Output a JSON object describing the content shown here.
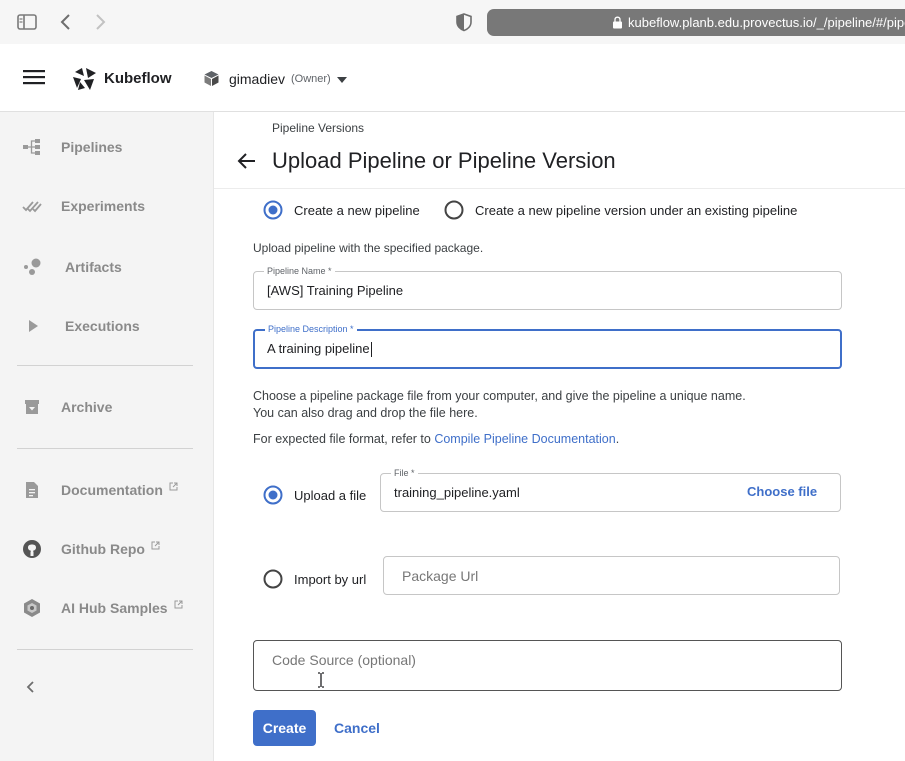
{
  "browser": {
    "url": "kubeflow.planb.edu.provectus.io/_/pipeline/#/pipeline_versions/new"
  },
  "header": {
    "brand": "Kubeflow",
    "namespace": "gimadiev",
    "namespace_role": "(Owner)"
  },
  "sidebar": {
    "items": [
      {
        "label": "Pipelines",
        "icon": "pipelines-icon"
      },
      {
        "label": "Experiments",
        "icon": "experiments-icon"
      },
      {
        "label": "Artifacts",
        "icon": "artifacts-icon"
      },
      {
        "label": "Executions",
        "icon": "executions-icon"
      },
      {
        "label": "Archive",
        "icon": "archive-icon"
      },
      {
        "label": "Documentation",
        "icon": "document-icon"
      },
      {
        "label": "Github Repo",
        "icon": "github-icon"
      },
      {
        "label": "AI Hub Samples",
        "icon": "ai-hub-icon"
      }
    ]
  },
  "main": {
    "breadcrumb": "Pipeline Versions",
    "title": "Upload Pipeline or Pipeline Version",
    "mode_options": {
      "new_pipeline": "Create a new pipeline",
      "new_version": "Create a new pipeline version under an existing pipeline",
      "selected": "new_pipeline"
    },
    "upload_helper": "Upload pipeline with the specified package.",
    "pipeline_name": {
      "label": "Pipeline Name *",
      "value": "[AWS] Training Pipeline"
    },
    "pipeline_description": {
      "label": "Pipeline Description *",
      "value": "A training pipeline"
    },
    "instructions": {
      "line1": "Choose a pipeline package file from your computer, and give the pipeline a unique name.",
      "line2": "You can also drag and drop the file here.",
      "format_prefix": "For expected file format, refer to ",
      "format_link": "Compile Pipeline Documentation",
      "format_suffix": "."
    },
    "source_options": {
      "upload_file": "Upload a file",
      "import_url": "Import by url",
      "selected": "upload_file"
    },
    "file": {
      "label": "File *",
      "value": "training_pipeline.yaml",
      "choose_label": "Choose file"
    },
    "package_url": {
      "placeholder": "Package Url"
    },
    "code_source": {
      "placeholder": "Code Source (optional)"
    },
    "create_label": "Create",
    "cancel_label": "Cancel"
  },
  "colors": {
    "accent": "#3f6fc9",
    "sidebar_bg": "#f4f4f4",
    "sidebar_text": "#8a8a8a"
  }
}
